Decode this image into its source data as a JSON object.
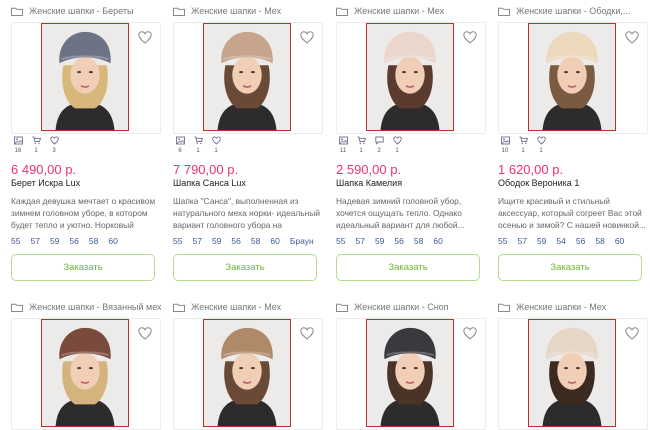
{
  "products": [
    {
      "category": "Женские шапки - Береты",
      "stats": {
        "photos": "16",
        "cart": "1",
        "likes": "3"
      },
      "price": "6 490,00 р.",
      "title": "Берет Искра Lux",
      "description": "Каждая девушка мечтает о красивом зимнем головном уборе, в котором будет тепло и уютно. Норковый бере...",
      "sizes": [
        "55",
        "57",
        "59",
        "56",
        "58",
        "60"
      ],
      "order_label": "Заказать",
      "hat_color": "#6e7285",
      "hair_color": "#d7b77a"
    },
    {
      "category": "Женские шапки - Мех",
      "stats": {
        "photos": "6",
        "cart": "1",
        "likes": "1"
      },
      "price": "7 790,00 р.",
      "title": "Шапка Санса Lux",
      "description": "Шапка \"Санса\", выполненная из натурального меха норки- идеальный вариант головного убора на каждый...",
      "sizes": [
        "55",
        "57",
        "59",
        "56",
        "58",
        "60",
        "Браун"
      ],
      "order_label": "Заказать",
      "hat_color": "#c6a58c",
      "hair_color": "#6a4a36"
    },
    {
      "category": "Женские шапки - Мех",
      "stats": {
        "photos": "11",
        "cart": "1",
        "comments": "2",
        "likes": "1"
      },
      "price": "2 590,00 р.",
      "title": "Шапка Камелия",
      "description": "Надевая зимний головной убор, хочется ощущать тепло. Однако идеальный вариант для любой...",
      "sizes": [
        "55",
        "57",
        "59",
        "56",
        "58",
        "60"
      ],
      "order_label": "Заказать",
      "hat_color": "#ead6cc",
      "hair_color": "#5b3b2d"
    },
    {
      "category": "Женские шапки - Ободки,...",
      "stats": {
        "photos": "10",
        "cart": "1",
        "likes": "1"
      },
      "price": "1 620,00 р.",
      "title": "Ободок Вероника 1",
      "description": "Ищите красивый и стильный аксессуар, который согреет Вас этой осенью и зимой? С нашей новинкой...",
      "sizes": [
        "55",
        "57",
        "59",
        "54",
        "56",
        "58",
        "60"
      ],
      "order_label": "Заказать",
      "hat_color": "#ecd9bd",
      "hair_color": "#7a5a40"
    },
    {
      "category": "Женские шапки - Вязанный мех...",
      "hat_color": "#7a4a3c",
      "hair_color": "#d4b47c"
    },
    {
      "category": "Женские шапки - Мех",
      "hat_color": "#b08a68",
      "hair_color": "#6a4a36"
    },
    {
      "category": "Женские шапки - Сноп",
      "hat_color": "#3a3a3e",
      "hair_color": "#4a3428"
    },
    {
      "category": "Женские шапки - Мех",
      "hat_color": "#e6d6c6",
      "hair_color": "#3a2a20"
    }
  ]
}
